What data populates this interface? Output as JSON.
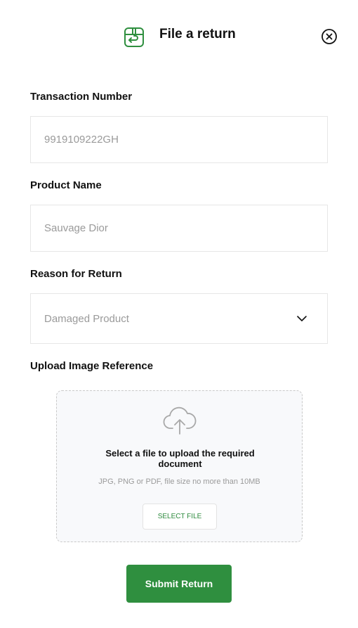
{
  "header": {
    "title": "File a return",
    "icon": "return-box-icon",
    "close_icon": "close-circle-icon"
  },
  "form": {
    "transaction_number": {
      "label": "Transaction Number",
      "value": "9919109222GH"
    },
    "product_name": {
      "label": "Product Name",
      "value": "Sauvage Dior"
    },
    "reason": {
      "label": "Reason for Return",
      "value": "Damaged Product",
      "icon": "chevron-down-icon"
    },
    "upload": {
      "label": "Upload Image Reference",
      "icon": "cloud-upload-icon",
      "title": "Select a file to upload the required document",
      "hint": "JPG, PNG or PDF, file size no more than 10MB",
      "button_label": "SELECT FILE"
    },
    "submit_label": "Submit Return"
  },
  "colors": {
    "accent": "#2f8f3f",
    "border": "#e6e6e6",
    "placeholder": "#9a9a9a"
  }
}
